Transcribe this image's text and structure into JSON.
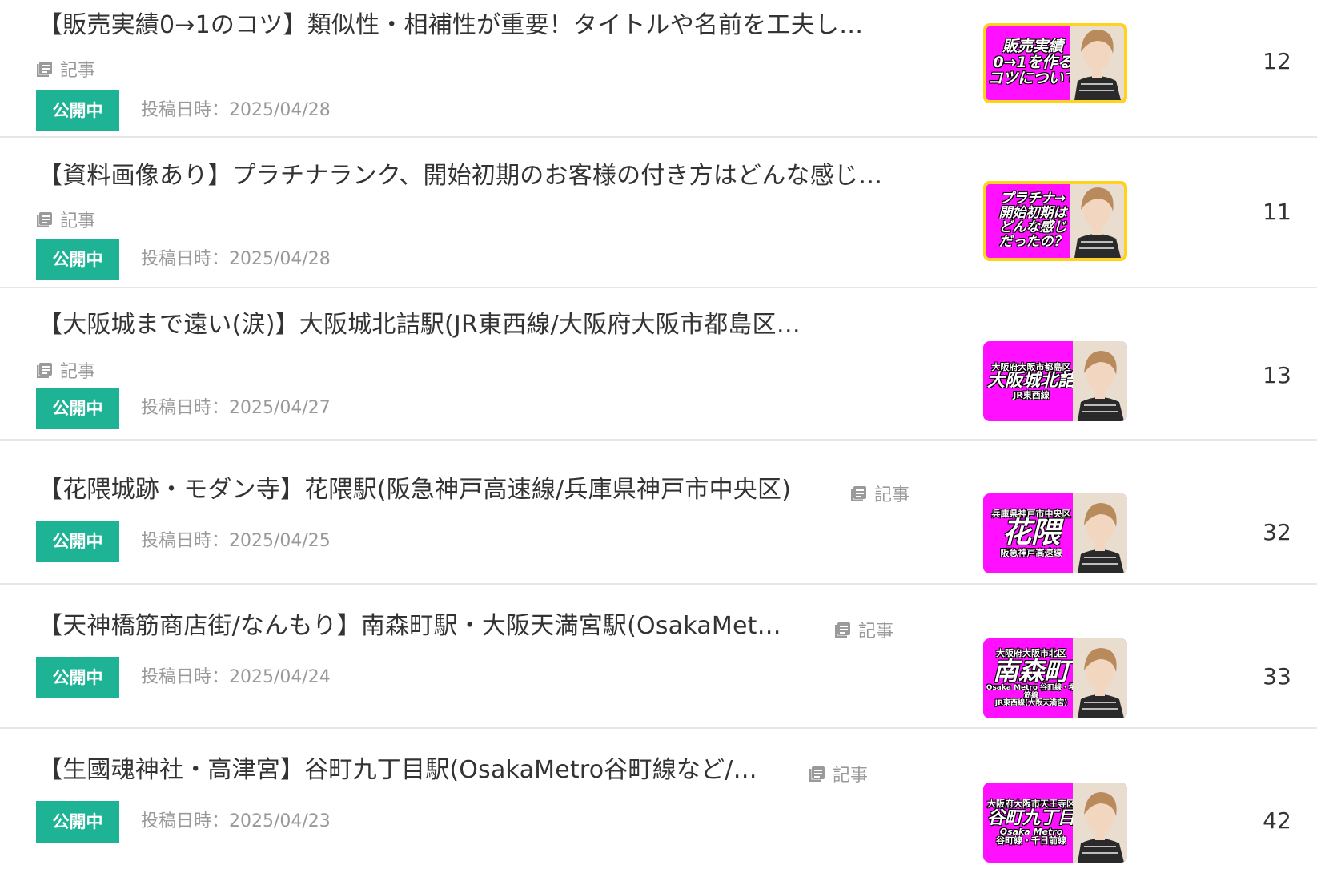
{
  "colors": {
    "status_bg": "#1db394",
    "thumb_bg": "#ff10ff",
    "thumb_frame": "#ffd21e",
    "muted_text": "#999999"
  },
  "icons": {
    "article": "article-icon"
  },
  "rows": [
    {
      "title": "【販売実績0→1のコツ】類似性・相補性が重要！タイトルや名前を工夫し…",
      "type_label": "記事",
      "status": "公開中",
      "date": "投稿日時：2025/04/28",
      "thumb_lines": [
        "販売実績",
        "0→1を作る",
        "コツについて"
      ],
      "count": "12"
    },
    {
      "title": "【資料画像あり】プラチナランク、開始初期のお客様の付き方はどんな感じ…",
      "type_label": "記事",
      "status": "公開中",
      "date": "投稿日時：2025/04/28",
      "thumb_lines": [
        "プラチナ→",
        "開始初期は",
        "どんな感じ",
        "だったの？"
      ],
      "count": "11"
    },
    {
      "title": "【大阪城まで遠い(涙)】大阪城北詰駅(JR東西線/大阪府大阪市都島区…",
      "type_label": "記事",
      "status": "公開中",
      "date": "投稿日時：2025/04/27",
      "thumb_top": "大阪府大阪市都島区",
      "thumb_main": "大阪城北詰",
      "thumb_bottom": "JR東西線",
      "count": "13"
    },
    {
      "title": "【花隈城跡・モダン寺】花隈駅(阪急神戸高速線/兵庫県神戸市中央区)",
      "type_label": "記事",
      "status": "公開中",
      "date": "投稿日時：2025/04/25",
      "thumb_top": "兵庫県神戸市中央区",
      "thumb_main": "花隈",
      "thumb_bottom": "阪急神戸高速線",
      "count": "32"
    },
    {
      "title": "【天神橋筋商店街/なんもり】南森町駅・大阪天満宮駅(OsakaMet…",
      "type_label": "記事",
      "status": "公開中",
      "date": "投稿日時：2025/04/24",
      "thumb_top": "大阪府大阪市北区",
      "thumb_main": "南森町",
      "thumb_bottom": "Osaka Metro 谷町線・堺筋線",
      "thumb_bottom2": "JR東西線(大阪天満宮)",
      "count": "33"
    },
    {
      "title": "【生國魂神社・高津宮】谷町九丁目駅(OsakaMetro谷町線など/…",
      "type_label": "記事",
      "status": "公開中",
      "date": "投稿日時：2025/04/23",
      "thumb_top": "大阪府大阪市天王寺区",
      "thumb_main": "谷町九丁目",
      "thumb_bottom": "Osaka Metro",
      "thumb_bottom2": "谷町線・千日前線",
      "count": "42"
    }
  ]
}
